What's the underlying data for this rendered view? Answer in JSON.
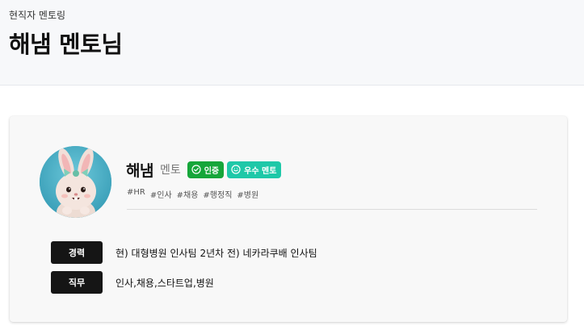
{
  "header": {
    "breadcrumb": "현직자 멘토링",
    "title": "해냄 멘토님"
  },
  "mentor": {
    "name": "해냄",
    "role": "멘토",
    "badges": [
      {
        "label": "인증",
        "icon": "check-circle-icon",
        "color": "#16a63a"
      },
      {
        "label": "우수 멘토",
        "icon": "smile-icon",
        "color": "#1ec8a8"
      }
    ],
    "tags": [
      "#HR",
      "#인사",
      "#채용",
      "#행정직",
      "#병원"
    ],
    "avatar": "bunny-avatar"
  },
  "info": {
    "career_label": "경력",
    "career_value": "현) 대형병원 인사팀 2년차 전) 네카라쿠배 인사팀",
    "job_label": "직무",
    "job_value": "인사,채용,스타트업,병원"
  }
}
